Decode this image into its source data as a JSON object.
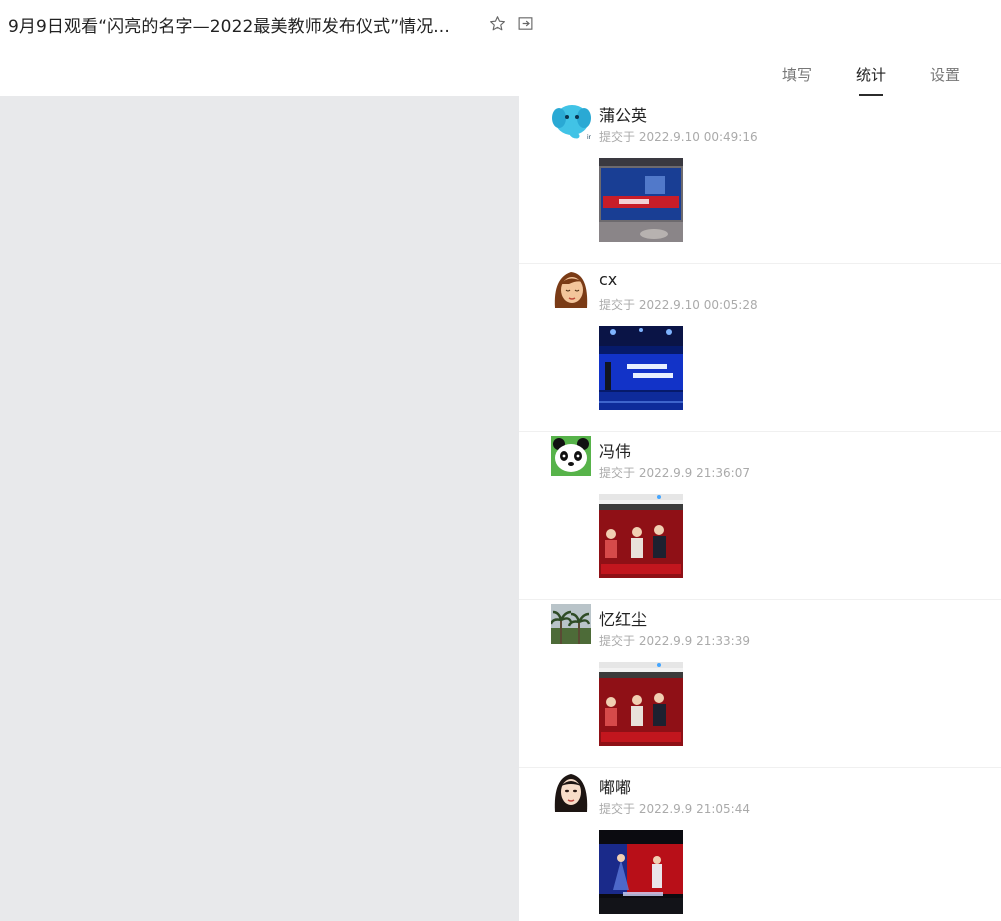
{
  "header": {
    "title": "9月9日观看“闪亮的名字—2022最美教师发布仪式”情况...",
    "star_icon": "star-icon",
    "exit_icon": "exit-icon"
  },
  "tabs": [
    {
      "label": "填写",
      "active": false
    },
    {
      "label": "统计",
      "active": true
    },
    {
      "label": "设置",
      "active": false
    }
  ],
  "submissions": [
    {
      "name": "蒲公英",
      "time": "提交于 2022.9.10 00:49:16",
      "avatar": "elephant-avatar",
      "photo": "tv-screen-photo"
    },
    {
      "name": "cx",
      "time": "提交于 2022.9.10 00:05:28",
      "avatar": "girl-avatar",
      "photo": "stage-blue-photo"
    },
    {
      "name": "冯伟",
      "time": "提交于 2022.9.9 21:36:07",
      "avatar": "panda-avatar",
      "photo": "broadcast-red-photo"
    },
    {
      "name": "忆红尘",
      "time": "提交于 2022.9.9 21:33:39",
      "avatar": "palm-trees-avatar",
      "photo": "broadcast-red-photo"
    },
    {
      "name": "嘟嘟",
      "time": "提交于 2022.9.9 21:05:44",
      "avatar": "woman-avatar",
      "photo": "stage-red-photo"
    }
  ]
}
